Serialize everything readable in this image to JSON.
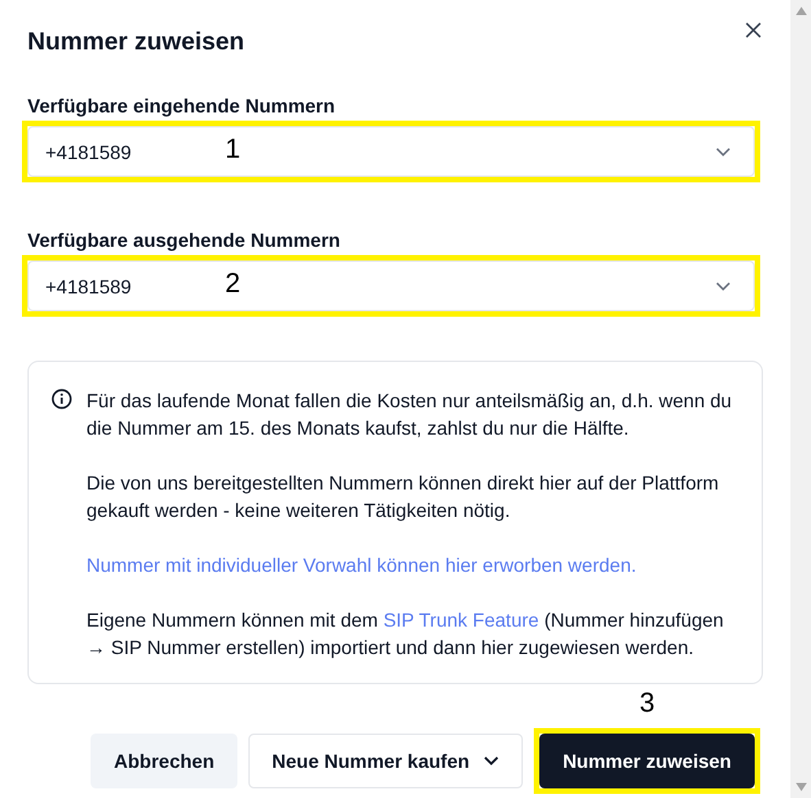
{
  "dialog": {
    "title": "Nummer zuweisen"
  },
  "fields": [
    {
      "label": "Verfügbare eingehende Nummern",
      "value": "+4181589",
      "highlighted": true,
      "marker": "1"
    },
    {
      "label": "Verfügbare ausgehende Nummern",
      "value": "+4181589",
      "highlighted": true,
      "marker": "2"
    }
  ],
  "info": {
    "paragraphs": [
      [
        {
          "text": "Für das laufende Monat fallen die Kosten nur anteilsmäßig an, d.h. wenn du die Nummer am 15. des Monats kaufst, zahlst du nur die Hälfte.",
          "link": false
        }
      ],
      [
        {
          "text": "Die von uns bereitgestellten Nummern können direkt hier auf der Plattform gekauft werden - keine weiteren Tätigkeiten nötig.",
          "link": false
        }
      ],
      [
        {
          "text": "Nummer mit individueller Vorwahl können hier erworben werden.",
          "link": true
        }
      ],
      [
        {
          "text": "Eigene Nummern können mit dem ",
          "link": false
        },
        {
          "text": "SIP Trunk Feature",
          "link": true
        },
        {
          "text": " (Nummer hinzufügen → SIP Nummer erstellen) importiert und dann hier zugewiesen werden.",
          "link": false
        }
      ]
    ]
  },
  "buttons": [
    {
      "label": "Abbrechen",
      "kind": "secondary",
      "highlighted": false
    },
    {
      "label": "Neue Nummer kaufen",
      "kind": "dropdown",
      "highlighted": false
    },
    {
      "label": "Nummer zuweisen",
      "kind": "primary",
      "highlighted": true,
      "marker": "3"
    }
  ]
}
